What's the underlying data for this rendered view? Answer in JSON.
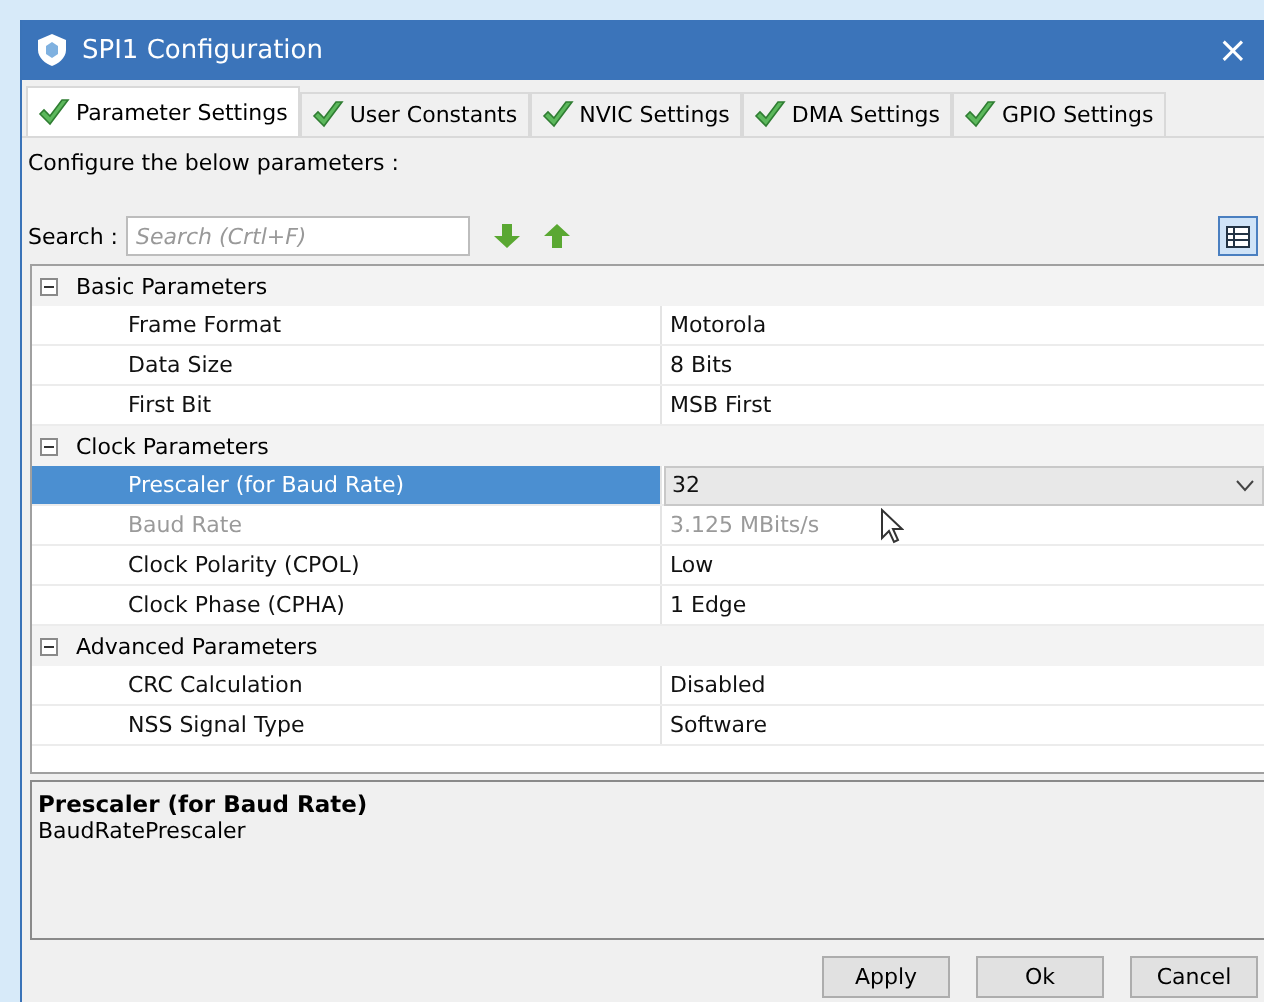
{
  "window": {
    "title": "SPI1 Configuration",
    "close": "×"
  },
  "tabs": [
    {
      "label": "Parameter Settings",
      "selected": true
    },
    {
      "label": "User Constants",
      "selected": false
    },
    {
      "label": "NVIC Settings",
      "selected": false
    },
    {
      "label": "DMA Settings",
      "selected": false
    },
    {
      "label": "GPIO Settings",
      "selected": false
    }
  ],
  "instruction": "Configure the below parameters :",
  "search": {
    "label": "Search :",
    "placeholder": "Search (Crtl+F)"
  },
  "groups": [
    {
      "name": "Basic Parameters",
      "expanded": true,
      "rows": [
        {
          "name": "Frame Format",
          "value": "Motorola",
          "kind": "text",
          "selected": false,
          "disabled": false
        },
        {
          "name": "Data Size",
          "value": "8 Bits",
          "kind": "text",
          "selected": false,
          "disabled": false
        },
        {
          "name": "First Bit",
          "value": "MSB First",
          "kind": "text",
          "selected": false,
          "disabled": false
        }
      ]
    },
    {
      "name": "Clock Parameters",
      "expanded": true,
      "rows": [
        {
          "name": "Prescaler (for Baud Rate)",
          "value": "32",
          "kind": "dropdown",
          "selected": true,
          "disabled": false
        },
        {
          "name": "Baud Rate",
          "value": "3.125 MBits/s",
          "kind": "text",
          "selected": false,
          "disabled": true
        },
        {
          "name": "Clock Polarity (CPOL)",
          "value": "Low",
          "kind": "text",
          "selected": false,
          "disabled": false
        },
        {
          "name": "Clock Phase (CPHA)",
          "value": "1 Edge",
          "kind": "text",
          "selected": false,
          "disabled": false
        }
      ]
    },
    {
      "name": "Advanced Parameters",
      "expanded": true,
      "rows": [
        {
          "name": "CRC Calculation",
          "value": "Disabled",
          "kind": "text",
          "selected": false,
          "disabled": false
        },
        {
          "name": "NSS Signal Type",
          "value": "Software",
          "kind": "text",
          "selected": false,
          "disabled": false
        }
      ]
    }
  ],
  "description": {
    "title": "Prescaler (for Baud Rate)",
    "body": "BaudRatePrescaler"
  },
  "buttons": [
    "Apply",
    "Ok",
    "Cancel"
  ]
}
